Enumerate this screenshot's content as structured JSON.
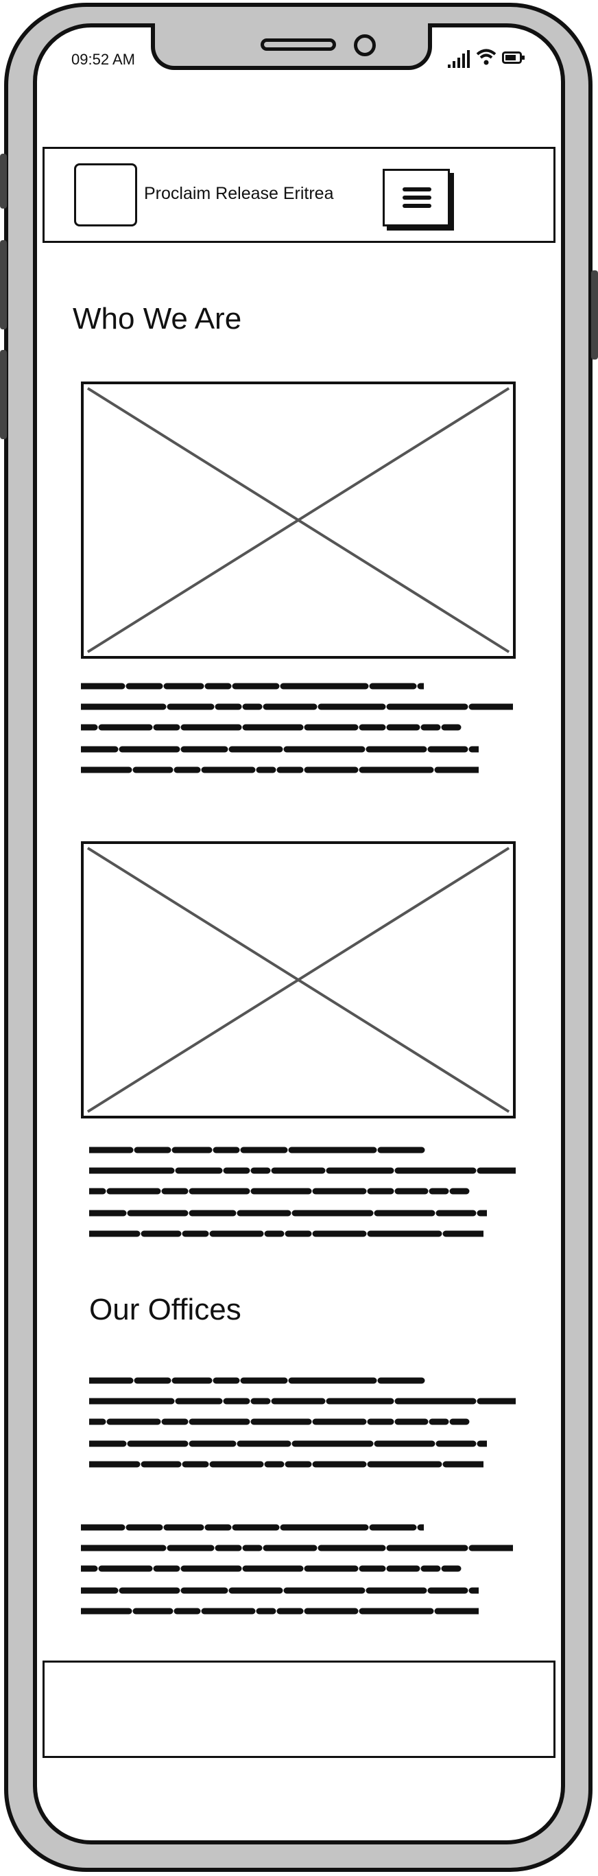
{
  "status_bar": {
    "time": "09:52 AM",
    "icons": [
      "signal-icon",
      "wifi-icon",
      "battery-icon"
    ]
  },
  "header": {
    "title": "Proclaim Release Eritrea",
    "logo": "logo-placeholder",
    "menu_icon": "hamburger-menu-icon"
  },
  "sections": {
    "who_we_are": {
      "heading": "Who We Are"
    },
    "our_offices": {
      "heading": "Our Offices"
    }
  },
  "content": {
    "image_placeholders": 2,
    "text_blocks": "squiggle placeholder text (illegible)"
  },
  "colors": {
    "frame": "#c4c4c4",
    "ink": "#111111",
    "placeholder_cross": "#555555",
    "screen": "#ffffff"
  }
}
